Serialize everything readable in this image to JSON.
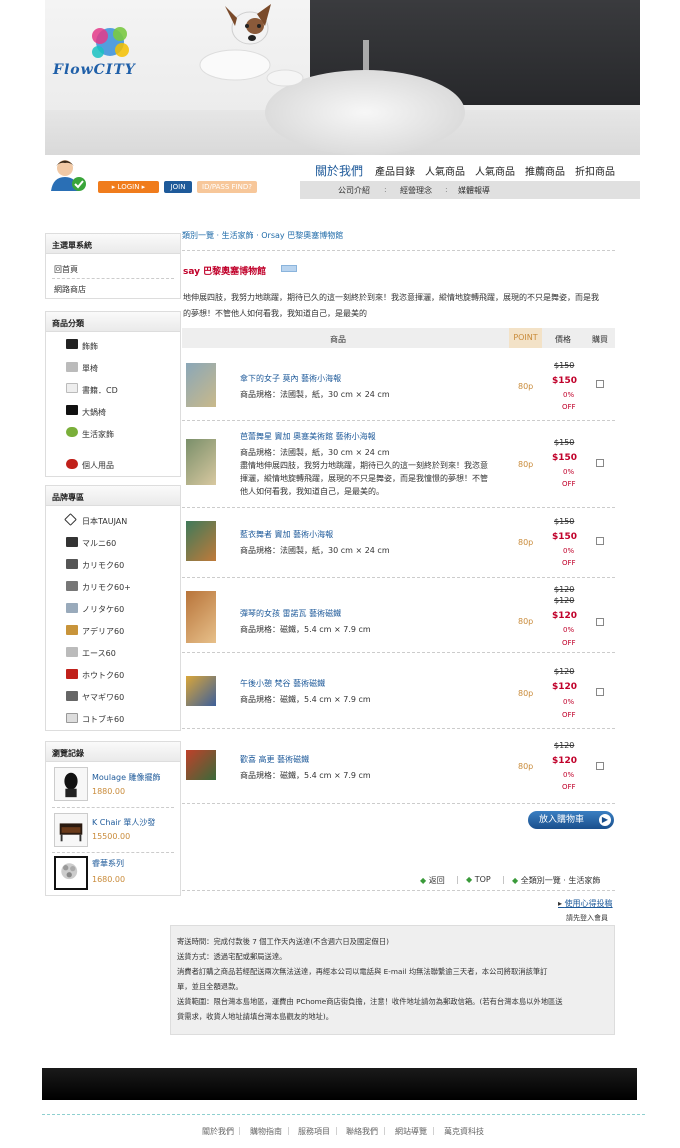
{
  "brand": {
    "logo_text": "FlowCITY"
  },
  "login": {
    "login_label": "LOGIN",
    "join_label": "JOIN",
    "idpass_label": "ID/PASS FIND?"
  },
  "nav": {
    "items": [
      "關於我們",
      "產品目錄",
      "人氣商品",
      "人氣商品",
      "推薦商品",
      "折扣商品"
    ],
    "sub_items": [
      "公司介紹",
      "經營理念",
      "媒體報導"
    ],
    "sub_sep": ":"
  },
  "sidebar": {
    "menu": {
      "title": "主選單系統",
      "items": [
        "回首頁",
        "網路商店"
      ]
    },
    "categories": {
      "title": "商品分類",
      "items": [
        "飾飾",
        "單椅",
        "書籍．CD",
        "大鍋椅",
        "生活家飾",
        "個人用品"
      ]
    },
    "brands": {
      "title": "品牌專區",
      "items": [
        "日本TAUJAN",
        "マルニ60",
        "カリモク60",
        "カリモク60+",
        "ノリタケ60",
        "アデリア60",
        "エース60",
        "ホウトク60",
        "ヤマギワ60",
        "コトブキ60"
      ]
    },
    "history": {
      "title": "瀏覽記錄",
      "items": [
        {
          "name": "Moulage 雕像擺飾",
          "price": "1880.00"
        },
        {
          "name": "K Chair 單人沙發",
          "price": "15500.00"
        },
        {
          "name": "睿華系列",
          "price": "1680.00"
        }
      ]
    }
  },
  "breadcrumb": "類別一覽 · 生活家飾 · Orsay 巴黎奧塞博物館",
  "product": {
    "title": "say 巴黎奧塞博物館",
    "desc_line1": "地伸展四肢，我努力地跳躍，期待已久的這一刻終於到來！我恣意揮灑，縱情地旋轉飛躍，展現的不只是舞姿，而是我",
    "desc_line2": "的夢想！不管他人如何看我，我知道自己，是最美的"
  },
  "table": {
    "headers": {
      "item": "商品",
      "point": "POINT",
      "price": "價格",
      "buy": "購買"
    },
    "rows": [
      {
        "name": "傘下的女子 莫內 藝術小海報",
        "spec": [
          "商品規格：法國製，紙，30 cm × 24 cm"
        ],
        "point": "80p",
        "old": "$150",
        "new": "$150",
        "pct": "0%",
        "off": "OFF",
        "colors": [
          "#8aa7b8",
          "#c9b98a"
        ]
      },
      {
        "name": "芭蕾舞星 竇加 奧塞美術館 藝術小海報",
        "spec": [
          "商品規格：法國製，紙，30 cm × 24 cm",
          "盡情地伸展四肢，我努力地跳躍，期待已久的這一刻終於到來！我恣意",
          "揮灑，縱情地旋轉飛躍，展現的不只是舞姿，而是我憧憬的夢想！不管",
          "他人如何看我，我知道自己，是最美的。"
        ],
        "point": "80p",
        "old": "$150",
        "new": "$150",
        "pct": "0%",
        "off": "OFF",
        "colors": [
          "#7a8f6a",
          "#d8c8a0"
        ]
      },
      {
        "name": "藍衣舞者 竇加 藝術小海報",
        "spec": [
          "商品規格：法國製，紙，30 cm × 24 cm"
        ],
        "point": "80p",
        "old": "$150",
        "new": "$150",
        "pct": "0%",
        "off": "OFF",
        "colors": [
          "#3f7a5a",
          "#c07a3a"
        ]
      },
      {
        "name": "彈琴的女孩 雷諾瓦 藝術磁鐵",
        "spec": [
          "商品規格：磁鐵，5.4 cm × 7.9 cm"
        ],
        "point": "80p",
        "old": "$120",
        "old2": "$120",
        "new": "$120",
        "pct": "0%",
        "off": "OFF",
        "colors": [
          "#b8743a",
          "#e7c08a"
        ]
      },
      {
        "name": "午後小憩 梵谷 藝術磁鐵",
        "spec": [
          "商品規格：磁鐵，5.4 cm × 7.9 cm"
        ],
        "point": "80p",
        "old": "$120",
        "new": "$120",
        "pct": "0%",
        "off": "OFF",
        "colors": [
          "#d9a63a",
          "#3d5f9a"
        ]
      },
      {
        "name": "歡喜 高更 藝術磁鐵",
        "spec": [
          "商品規格：磁鐵，5.4 cm × 7.9 cm"
        ],
        "point": "80p",
        "old": "$120",
        "new": "$120",
        "pct": "0%",
        "off": "OFF",
        "colors": [
          "#c0402a",
          "#3a6a3a"
        ]
      }
    ]
  },
  "cart_button": "放入購物車",
  "links": {
    "back": "返回",
    "top": "TOP",
    "category": "全類別一覽 · 生活家飾"
  },
  "share": "使用心得投稿",
  "login_first": "請先登入會員",
  "info": [
    "寄送時間：完成付款後 7 個工作天內送達(不含週六日及國定假日)",
    "送貨方式：透過宅配或郵局送達。",
    "消費者訂購之商品若經配送兩次無法送達，再經本公司以電話與 E-mail 均無法聯繫逾三天者，本公司將取消該筆訂",
    "單，並且全額退款。",
    "送貨範圍：限台灣本島地區，運費由 PChome商店街負擔，注意！收件地址請勿為郵政信箱。(若有台灣本島以外地區送",
    "貨需求，收貨人地址請填台灣本島觀友的地址)。"
  ],
  "footer": [
    "關於我們",
    "購物指南",
    "服務項目",
    "聯絡我們",
    "網站導覽",
    "萬克資科技"
  ]
}
